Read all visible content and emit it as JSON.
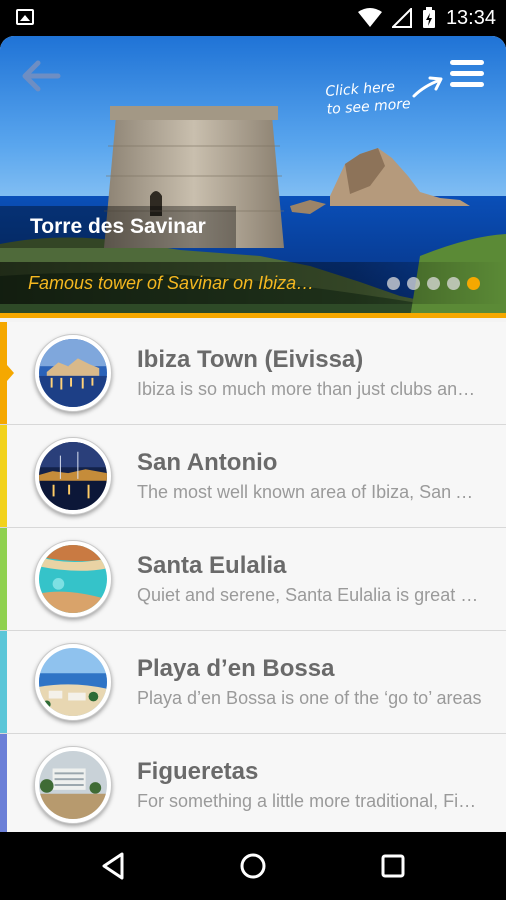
{
  "status_bar": {
    "time": "13:34",
    "icons": [
      "image-notification-icon",
      "wifi-icon",
      "signal-icon",
      "battery-charging-icon"
    ]
  },
  "hero": {
    "title": "Torre des Savinar",
    "subtitle": "Famous tower of Savinar on Ibiza…",
    "hint_line1": "Click here",
    "hint_line2": "to see more",
    "slide_count": 5,
    "active_slide_index": 4,
    "accent_color": "#f5a800"
  },
  "places": [
    {
      "title": "Ibiza Town (Eivissa)",
      "description": "Ibiza is so much more than just clubs and parties",
      "stripe_color": "#f5a800",
      "thumb_icon": "ibiza-town-photo"
    },
    {
      "title": "San Antonio",
      "description": "The most well known area of Ibiza, San Antonio",
      "stripe_color": "#f2d21b",
      "thumb_icon": "san-antonio-photo"
    },
    {
      "title": "Santa Eulalia",
      "description": "Quiet and serene, Santa Eulalia is great for families",
      "stripe_color": "#8fd14f",
      "thumb_icon": "santa-eulalia-photo"
    },
    {
      "title": "Playa d’en Bossa",
      "description": "Playa d’en Bossa is one of the ‘go to’ areas",
      "stripe_color": "#5bc6d8",
      "thumb_icon": "playa-den-bossa-photo"
    },
    {
      "title": "Figueretas",
      "description": "For something a little more traditional, Figueretas",
      "stripe_color": "#6b7fd7",
      "thumb_icon": "figueretas-photo"
    }
  ],
  "nav_bar": {
    "buttons": [
      "back-nav-icon",
      "home-nav-icon",
      "recents-nav-icon"
    ]
  }
}
